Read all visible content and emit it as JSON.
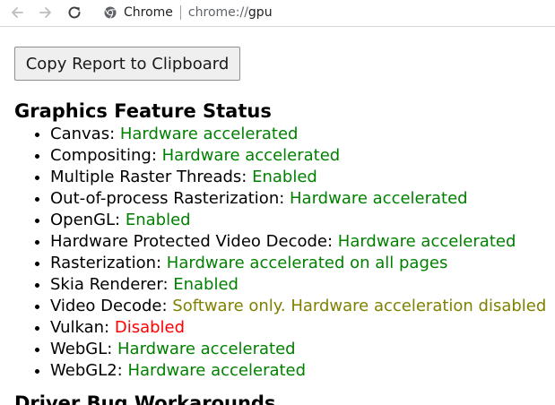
{
  "toolbar": {
    "site_chip_label": "Chrome",
    "url_scheme": "chrome://",
    "url_host": "gpu"
  },
  "page": {
    "copy_button_label": "Copy Report to Clipboard",
    "feature_status_title": "Graphics Feature Status",
    "next_section_title": "Driver Bug Workarounds"
  },
  "features": [
    {
      "name": "Canvas: ",
      "status": "Hardware accelerated",
      "status_color": "#008000"
    },
    {
      "name": "Compositing: ",
      "status": "Hardware accelerated",
      "status_color": "#008000"
    },
    {
      "name": "Multiple Raster Threads: ",
      "status": "Enabled",
      "status_color": "#008000"
    },
    {
      "name": "Out-of-process Rasterization: ",
      "status": "Hardware accelerated",
      "status_color": "#008000"
    },
    {
      "name": "OpenGL: ",
      "status": "Enabled",
      "status_color": "#008000"
    },
    {
      "name": "Hardware Protected Video Decode: ",
      "status": "Hardware accelerated",
      "status_color": "#008000"
    },
    {
      "name": "Rasterization: ",
      "status": "Hardware accelerated on all pages",
      "status_color": "#008000"
    },
    {
      "name": "Skia Renderer: ",
      "status": "Enabled",
      "status_color": "#008000"
    },
    {
      "name": "Video Decode: ",
      "status": "Software only. Hardware acceleration disabled",
      "status_color": "#808000"
    },
    {
      "name": "Vulkan: ",
      "status": "Disabled",
      "status_color": "#ff0000"
    },
    {
      "name": "WebGL: ",
      "status": "Hardware accelerated",
      "status_color": "#008000"
    },
    {
      "name": "WebGL2: ",
      "status": "Hardware accelerated",
      "status_color": "#008000"
    }
  ]
}
